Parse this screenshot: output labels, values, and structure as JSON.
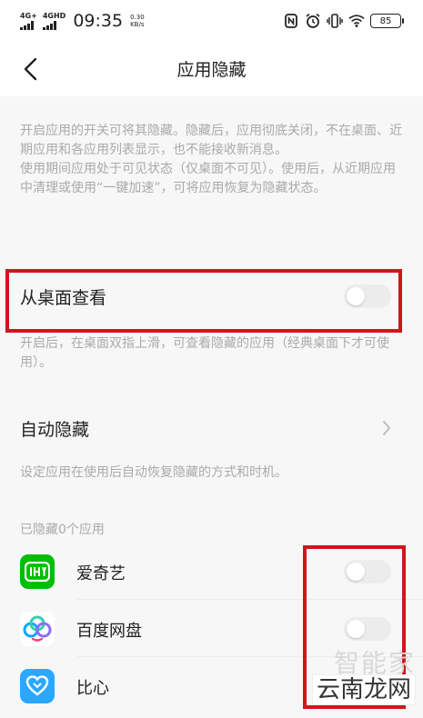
{
  "status_bar": {
    "network1": "4G+",
    "network2": "4GHD",
    "time": "09:35",
    "speed_value": "0.30",
    "speed_unit": "KB/s",
    "battery": "85"
  },
  "nav": {
    "title": "应用隐藏"
  },
  "intro": {
    "line1": "开启应用的开关可将其隐藏。隐藏后，应用彻底关闭，不在桌面、近期应用和各应用列表显示，也不能接收新消息。",
    "line2": "使用期间应用处于可见状态（仅桌面不可见）。使用后，从近期应用中清理或使用“一键加速”，可将应用恢复为隐藏状态。"
  },
  "desktop_view": {
    "label": "从桌面查看",
    "enabled": false,
    "hint": "开启后，在桌面双指上滑，可查看隐藏的应用（经典桌面下才可使用）。"
  },
  "auto_hide": {
    "label": "自动隐藏",
    "hint": "设定应用在使用后自动恢复隐藏的方式和时机。"
  },
  "apps_section": {
    "label": "已隐藏0个应用",
    "apps": [
      {
        "name": "爱奇艺",
        "icon": "iqiyi-icon",
        "color": "#00be06",
        "hidden": false
      },
      {
        "name": "百度网盘",
        "icon": "baidu-netdisk-icon",
        "color": "#06a7ff",
        "hidden": false
      },
      {
        "name": "比心",
        "icon": "bixin-icon",
        "color": "#2aa8ff",
        "hidden": false
      }
    ]
  },
  "watermark": {
    "top": "智能家",
    "bottom": "云南龙网"
  },
  "colors": {
    "highlight": "#d2141c",
    "hint_text": "#aaaaaa",
    "background": "#f7f7f7"
  }
}
